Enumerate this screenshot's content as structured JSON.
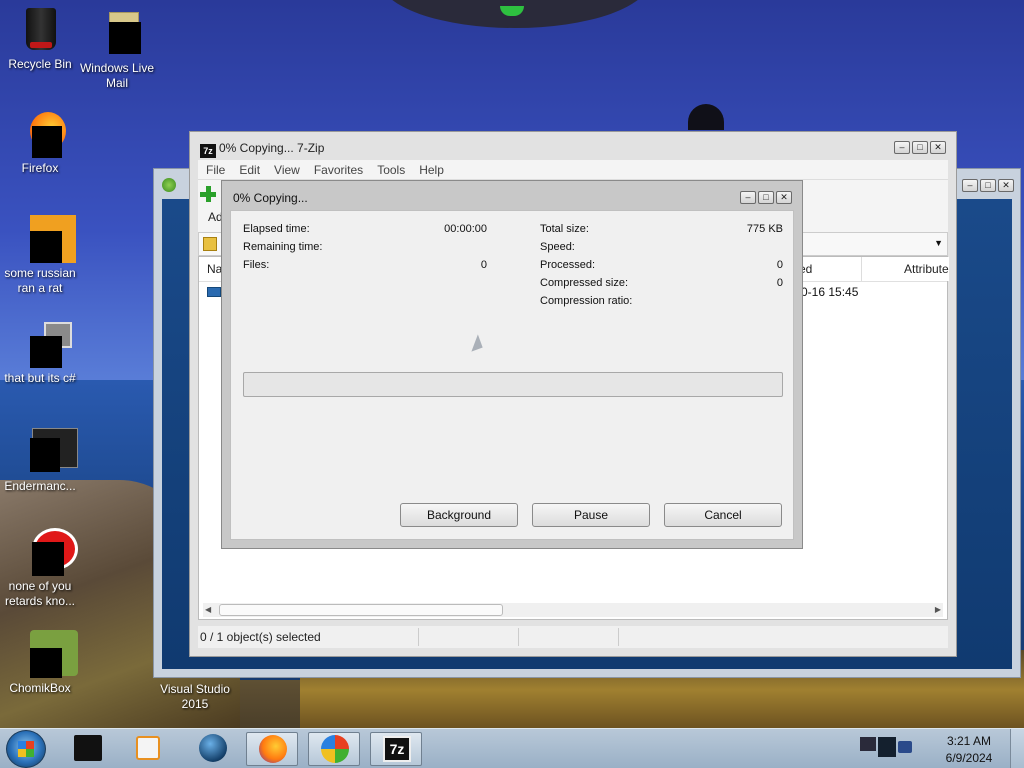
{
  "desktop": {
    "icons": [
      {
        "label": "Recycle Bin"
      },
      {
        "label": "Windows Live Mail"
      },
      {
        "label": "Firefox"
      },
      {
        "label": "some russian ran a rat"
      },
      {
        "label": "that but its c#"
      },
      {
        "label": "Endermanc..."
      },
      {
        "label": "none of you retards kno..."
      },
      {
        "label": "ChomikBox"
      },
      {
        "label": "Visual Studio 2015"
      }
    ]
  },
  "zip_window": {
    "title": "0% Copying... 7-Zip",
    "icon_text": "7z",
    "menu": [
      "File",
      "Edit",
      "View",
      "Favorites",
      "Tools",
      "Help"
    ],
    "toolbar_add_label": "Ad",
    "columns": {
      "name": "Na",
      "modified": "ed",
      "attributes": "Attribute"
    },
    "row_modified": "0-16 15:45",
    "status": "0 / 1 object(s) selected"
  },
  "dialog": {
    "title": "0% Copying...",
    "left_labels": {
      "elapsed": "Elapsed time:",
      "remaining": "Remaining time:",
      "files": "Files:"
    },
    "left_values": {
      "elapsed": "00:00:00",
      "remaining": "",
      "files": "0"
    },
    "right_labels": {
      "total": "Total size:",
      "speed": "Speed:",
      "processed": "Processed:",
      "compressed": "Compressed size:",
      "ratio": "Compression ratio:"
    },
    "right_values": {
      "total": "775 KB",
      "speed": "",
      "processed": "0",
      "compressed": "0",
      "ratio": ""
    },
    "progress_fraction": 0,
    "buttons": {
      "background": "Background",
      "pause": "Pause",
      "cancel": "Cancel"
    }
  },
  "taskbar": {
    "time": "3:21 AM",
    "date": "6/9/2024",
    "app_7z_label": "7z"
  },
  "colors": {
    "progress_green": "#27b33c",
    "taskbar": "#9ab0c6"
  }
}
